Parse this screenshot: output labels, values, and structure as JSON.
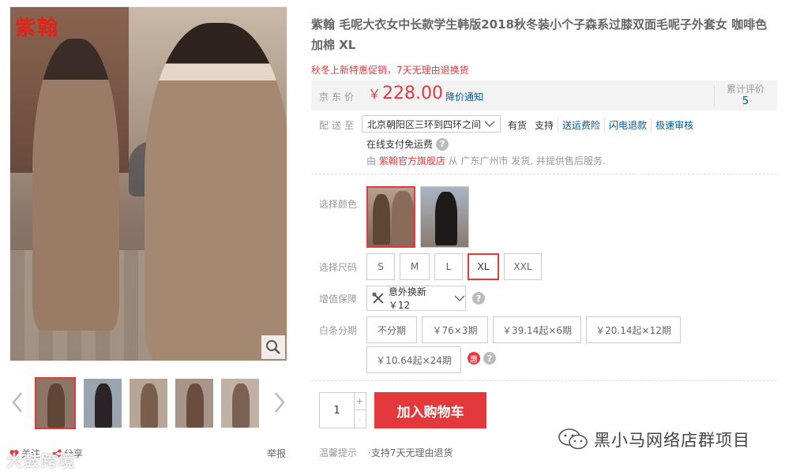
{
  "gallery": {
    "brand_stamp": "紫翰",
    "thumbnails": [
      {
        "name": "thumb-1",
        "selected": true,
        "bg": "#8c7466",
        "fig": "#5e4536"
      },
      {
        "name": "thumb-2",
        "selected": false,
        "bg": "#9aa3b0",
        "fig": "#2a2426"
      },
      {
        "name": "thumb-3",
        "selected": false,
        "bg": "#b7a697",
        "fig": "#7a5e4c"
      },
      {
        "name": "thumb-4",
        "selected": false,
        "bg": "#a7958a",
        "fig": "#6b4c3e"
      },
      {
        "name": "thumb-5",
        "selected": false,
        "bg": "#bfb1a4",
        "fig": "#7c6052"
      }
    ],
    "follow_label": "关注",
    "share_label": "分享",
    "report_label": "举报",
    "watermark_left": "大鼓跨境"
  },
  "product": {
    "title": "紫翰 毛呢大衣女中长款学生韩版2018秋冬装小个子森系过膝双面毛呢子外套女 咖啡色加棉 XL",
    "promo": "秋冬上新特惠促销，7天无理由退换货"
  },
  "price": {
    "label": "京东价",
    "currency": "￥",
    "value": "228.00",
    "notify_label": "降价通知",
    "review_label": "累计评价",
    "review_count": "5"
  },
  "shipping": {
    "label": "配送至",
    "address": "北京朝阳区三环到四环之间",
    "stock": "有货",
    "support": "支持",
    "services": [
      "送运费险",
      "闪电退款",
      "极速审核"
    ],
    "online_pay": "在线支付免运费",
    "seller_prefix": "由",
    "seller_shop": "紫翰官方旗舰店",
    "seller_suffix": "从 广东广州市 发货, 并提供售后服务."
  },
  "color": {
    "label": "选择颜色"
  },
  "size": {
    "label": "选择尺码",
    "options": [
      "S",
      "M",
      "L",
      "XL",
      "XXL"
    ],
    "selected": "XL"
  },
  "service": {
    "label": "增值保障",
    "option": "意外换新 ￥12"
  },
  "ious": {
    "label": "白条分期",
    "options": [
      "不分期",
      "￥76×3期",
      "￥39.14起×6期",
      "￥20.14起×12期",
      "￥10.64起×24期"
    ],
    "hui_badge": "惠"
  },
  "buy": {
    "quantity": "1",
    "plus": "+",
    "minus": "-",
    "cart_label": "加入购物车"
  },
  "tip": {
    "label": "温馨提示",
    "text": "·支持7天无理由退货"
  },
  "watermark_right": "黑小马网络店群项目",
  "colors": {
    "accent": "#e4393c",
    "link": "#005aa0"
  }
}
